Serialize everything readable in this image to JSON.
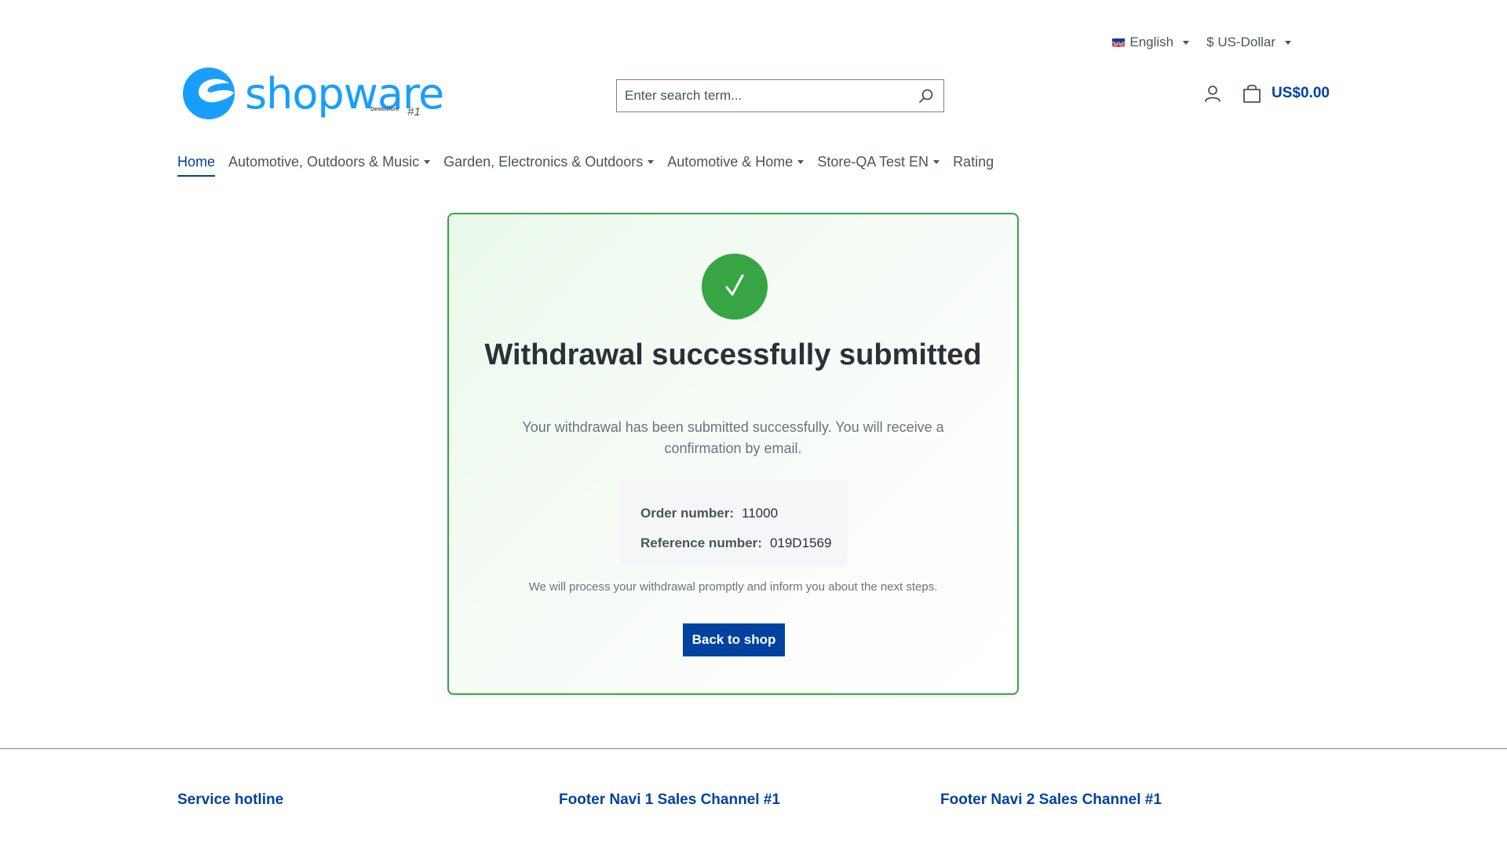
{
  "topbar": {
    "language": "English",
    "currency": "$ US-Dollar"
  },
  "header": {
    "logo": {
      "brand": "shopware",
      "sub": "Demostore",
      "number": "#1"
    },
    "search": {
      "placeholder": "Enter search term..."
    },
    "cart_total": "US$0.00"
  },
  "nav": {
    "items": [
      {
        "label": "Home"
      },
      {
        "label": "Automotive, Outdoors & Music"
      },
      {
        "label": "Garden, Electronics & Outdoors"
      },
      {
        "label": "Automotive & Home"
      },
      {
        "label": "Store-QA Test EN"
      },
      {
        "label": "Rating"
      }
    ]
  },
  "card": {
    "title": "Withdrawal successfully submitted",
    "message": "Your withdrawal has been submitted successfully. You will receive a confirmation by email.",
    "order_label": "Order number:",
    "order_value": "11000",
    "reference_label": "Reference number:",
    "reference_value": "019D1569",
    "note": "We will process your withdrawal promptly and inform you about the next steps.",
    "button": "Back to shop"
  },
  "footer": {
    "col1": "Service hotline",
    "col2": "Footer Navi 1 Sales Channel #1",
    "col3": "Footer Navi 2 Sales Channel #1"
  },
  "colors": {
    "brand_blue": "#0042a0",
    "logo_blue": "#189eff",
    "success_green": "#37a544"
  }
}
